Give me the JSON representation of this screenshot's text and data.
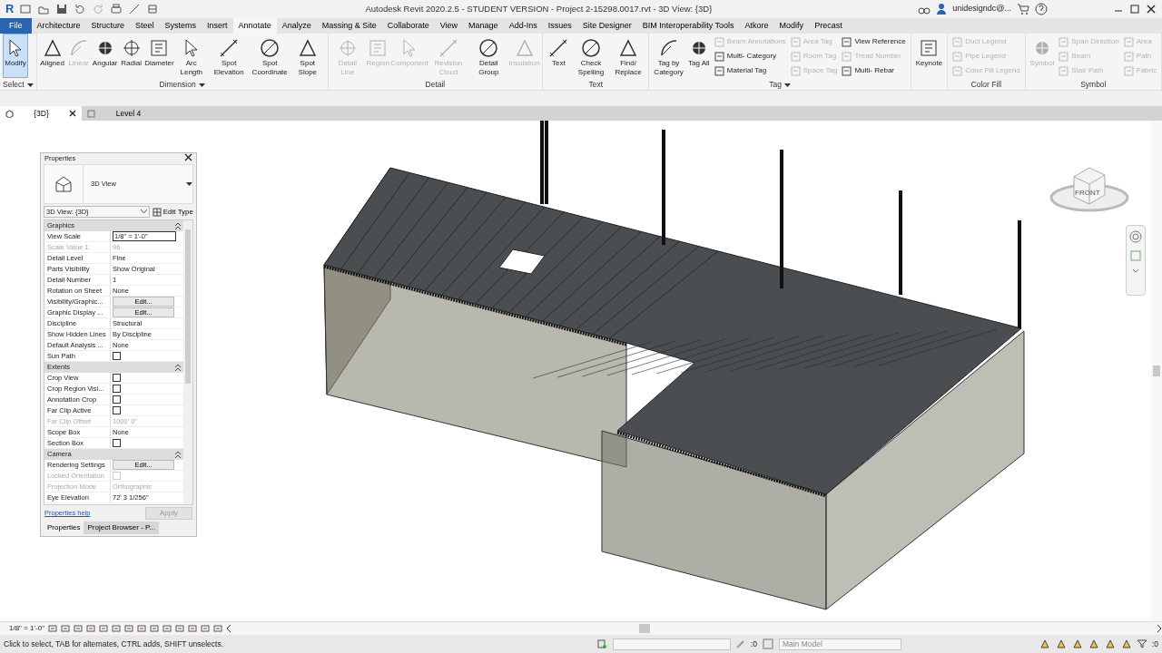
{
  "window": {
    "title": "Autodesk Revit 2020.2.5 - STUDENT VERSION - Project 2-15298.0017.rvt - 3D View: {3D}",
    "user": "unidesigndc@...",
    "app_letter": "R"
  },
  "menu_tabs": [
    {
      "label": "File",
      "kind": "file",
      "selected": false
    },
    {
      "label": "Architecture",
      "kind": "tab",
      "selected": false
    },
    {
      "label": "Structure",
      "kind": "tab",
      "selected": false
    },
    {
      "label": "Steel",
      "kind": "tab",
      "selected": false
    },
    {
      "label": "Systems",
      "kind": "tab",
      "selected": false
    },
    {
      "label": "Insert",
      "kind": "tab",
      "selected": false
    },
    {
      "label": "Annotate",
      "kind": "tab",
      "selected": true
    },
    {
      "label": "Analyze",
      "kind": "tab",
      "selected": false
    },
    {
      "label": "Massing & Site",
      "kind": "tab",
      "selected": false
    },
    {
      "label": "Collaborate",
      "kind": "tab",
      "selected": false
    },
    {
      "label": "View",
      "kind": "tab",
      "selected": false
    },
    {
      "label": "Manage",
      "kind": "tab",
      "selected": false
    },
    {
      "label": "Add-Ins",
      "kind": "tab",
      "selected": false
    },
    {
      "label": "Issues",
      "kind": "tab",
      "selected": false
    },
    {
      "label": "Site Designer",
      "kind": "tab",
      "selected": false
    },
    {
      "label": "BIM Interoperability Tools",
      "kind": "tab",
      "selected": false
    },
    {
      "label": "Atkore",
      "kind": "tab",
      "selected": false
    },
    {
      "label": "Modify",
      "kind": "tab",
      "selected": false
    },
    {
      "label": "Precast",
      "kind": "tab",
      "selected": false
    }
  ],
  "ribbon": [
    {
      "title": "Select",
      "dropdown": true,
      "items": [
        {
          "kind": "large",
          "label": "Modify",
          "disabled": false,
          "selected": true
        }
      ]
    },
    {
      "title": "Dimension",
      "dropdown": true,
      "items": [
        {
          "kind": "large",
          "label": "Aligned",
          "disabled": false,
          "selected": false
        },
        {
          "kind": "large",
          "label": "Linear",
          "disabled": true,
          "selected": false
        },
        {
          "kind": "large",
          "label": "Angular",
          "disabled": false,
          "selected": false
        },
        {
          "kind": "large",
          "label": "Radial",
          "disabled": false,
          "selected": false
        },
        {
          "kind": "large",
          "label": "Diameter",
          "disabled": false,
          "selected": false
        },
        {
          "kind": "large",
          "label": "Arc Length",
          "disabled": false,
          "selected": false
        },
        {
          "kind": "large",
          "label": "Spot Elevation",
          "disabled": false,
          "selected": false
        },
        {
          "kind": "large",
          "label": "Spot Coordinate",
          "disabled": false,
          "selected": false
        },
        {
          "kind": "large",
          "label": "Spot Slope",
          "disabled": false,
          "selected": false
        }
      ]
    },
    {
      "title": "Detail",
      "dropdown": false,
      "items": [
        {
          "kind": "large",
          "label": "Detail Line",
          "disabled": true,
          "selected": false
        },
        {
          "kind": "large",
          "label": "Region",
          "disabled": true,
          "selected": false
        },
        {
          "kind": "large",
          "label": "Component",
          "disabled": true,
          "selected": false
        },
        {
          "kind": "large",
          "label": "Revision Cloud",
          "disabled": true,
          "selected": false
        },
        {
          "kind": "large",
          "label": "Detail Group",
          "disabled": false,
          "selected": false
        },
        {
          "kind": "large",
          "label": "Insulation",
          "disabled": true,
          "selected": false
        }
      ]
    },
    {
      "title": "Text",
      "dropdown": false,
      "items": [
        {
          "kind": "large",
          "label": "Text",
          "disabled": false,
          "selected": false
        },
        {
          "kind": "large",
          "label": "Check Spelling",
          "disabled": false,
          "selected": false
        },
        {
          "kind": "large",
          "label": "Find/ Replace",
          "disabled": false,
          "selected": false
        }
      ]
    },
    {
      "title": "Tag",
      "dropdown": true,
      "items": [
        {
          "kind": "large",
          "label": "Tag by Category",
          "disabled": false,
          "selected": false
        },
        {
          "kind": "large",
          "label": "Tag All",
          "disabled": false,
          "selected": false
        },
        {
          "kind": "stack",
          "tools": [
            {
              "label": "Beam Annotations",
              "disabled": true
            },
            {
              "label": "Multi- Category",
              "disabled": false
            },
            {
              "label": "Material Tag",
              "disabled": false
            }
          ]
        },
        {
          "kind": "stack",
          "tools": [
            {
              "label": "Area Tag",
              "disabled": true
            },
            {
              "label": "Room Tag",
              "disabled": true
            },
            {
              "label": "Space Tag",
              "disabled": true
            }
          ]
        },
        {
          "kind": "stack",
          "tools": [
            {
              "label": "View Reference",
              "disabled": false
            },
            {
              "label": "Tread Number",
              "disabled": true
            },
            {
              "label": "Multi- Rebar",
              "disabled": false
            }
          ]
        }
      ]
    },
    {
      "items": [
        {
          "kind": "large",
          "label": "Keynote",
          "disabled": false,
          "selected": false
        }
      ]
    },
    {
      "title": "Color Fill",
      "dropdown": false,
      "items": [
        {
          "kind": "stack",
          "tools": [
            {
              "label": "Duct Legend",
              "disabled": true
            },
            {
              "label": "Pipe Legend",
              "disabled": true
            },
            {
              "label": "Color Fill Legend",
              "disabled": true
            }
          ]
        }
      ]
    },
    {
      "title": "Symbol",
      "dropdown": false,
      "items": [
        {
          "kind": "large",
          "label": "Symbol",
          "disabled": true,
          "selected": false
        },
        {
          "kind": "stack",
          "tools": [
            {
              "label": "Span Direction",
              "disabled": true
            },
            {
              "label": "Beam",
              "disabled": true
            },
            {
              "label": "Stair Path",
              "disabled": true
            }
          ]
        },
        {
          "kind": "stack",
          "tools": [
            {
              "label": "Area",
              "disabled": true
            },
            {
              "label": "Path",
              "disabled": true
            },
            {
              "label": "Fabric",
              "disabled": true
            }
          ]
        }
      ]
    }
  ],
  "view_tabs": [
    {
      "label": "{3D}",
      "selected": true
    },
    {
      "label": "Level 4",
      "selected": false
    }
  ],
  "properties": {
    "title": "Properties",
    "type_name": "3D View",
    "view_selector": "3D View: {3D}",
    "edit_type": "Edit Type",
    "groups": [
      {
        "name": "Graphics",
        "rows": [
          {
            "label": "View Scale",
            "kind": "input",
            "value": "1/8\" = 1'-0\"",
            "disabled": false
          },
          {
            "label": "Scale Value    1:",
            "kind": "text",
            "value": "96",
            "disabled": true
          },
          {
            "label": "Detail Level",
            "kind": "text",
            "value": "Fine",
            "disabled": false
          },
          {
            "label": "Parts Visibility",
            "kind": "text",
            "value": "Show Original",
            "disabled": false
          },
          {
            "label": "Detail Number",
            "kind": "text",
            "value": "1",
            "disabled": false
          },
          {
            "label": "Rotation on Sheet",
            "kind": "text",
            "value": "None",
            "disabled": false
          },
          {
            "label": "Visibility/Graphic...",
            "kind": "button",
            "value": "Edit...",
            "disabled": false
          },
          {
            "label": "Graphic Display ...",
            "kind": "button",
            "value": "Edit...",
            "disabled": false
          },
          {
            "label": "Discipline",
            "kind": "text",
            "value": "Structural",
            "disabled": false
          },
          {
            "label": "Show Hidden Lines",
            "kind": "text",
            "value": "By Discipline",
            "disabled": false
          },
          {
            "label": "Default Analysis ...",
            "kind": "text",
            "value": "None",
            "disabled": false
          },
          {
            "label": "Sun Path",
            "kind": "checkbox",
            "checked": false,
            "disabled": false
          }
        ]
      },
      {
        "name": "Extents",
        "rows": [
          {
            "label": "Crop View",
            "kind": "checkbox",
            "checked": false,
            "disabled": false
          },
          {
            "label": "Crop Region Visi...",
            "kind": "checkbox",
            "checked": false,
            "disabled": false
          },
          {
            "label": "Annotation Crop",
            "kind": "checkbox",
            "checked": false,
            "disabled": false
          },
          {
            "label": "Far Clip Active",
            "kind": "checkbox",
            "checked": false,
            "disabled": false
          },
          {
            "label": "Far Clip Offset",
            "kind": "text",
            "value": "1000'  0\"",
            "disabled": true
          },
          {
            "label": "Scope Box",
            "kind": "text",
            "value": "None",
            "disabled": false
          },
          {
            "label": "Section Box",
            "kind": "checkbox",
            "checked": false,
            "disabled": false
          }
        ]
      },
      {
        "name": "Camera",
        "rows": [
          {
            "label": "Rendering Settings",
            "kind": "button",
            "value": "Edit...",
            "disabled": false
          },
          {
            "label": "Locked Orientation",
            "kind": "checkbox",
            "checked": false,
            "disabled": true
          },
          {
            "label": "Projection Mode",
            "kind": "text",
            "value": "Orthographic",
            "disabled": true
          },
          {
            "label": "Eye Elevation",
            "kind": "text",
            "value": "72'  3 1/256\"",
            "disabled": false
          }
        ]
      }
    ],
    "help_link": "Properties help",
    "apply": {
      "label": "Apply",
      "disabled": true
    },
    "tabs": [
      {
        "label": "Properties",
        "selected": true
      },
      {
        "label": "Project Browser - P...",
        "selected": false
      }
    ]
  },
  "view_cube": {
    "face": "FRONT"
  },
  "view_bar": {
    "scale": "1/8\" = 1'-0\""
  },
  "status_bar": {
    "message": "Click to select, TAB for alternates, CTRL adds, SHIFT unselects.",
    "count_left": ":0",
    "model": "Main Model",
    "count_right": ":0"
  }
}
